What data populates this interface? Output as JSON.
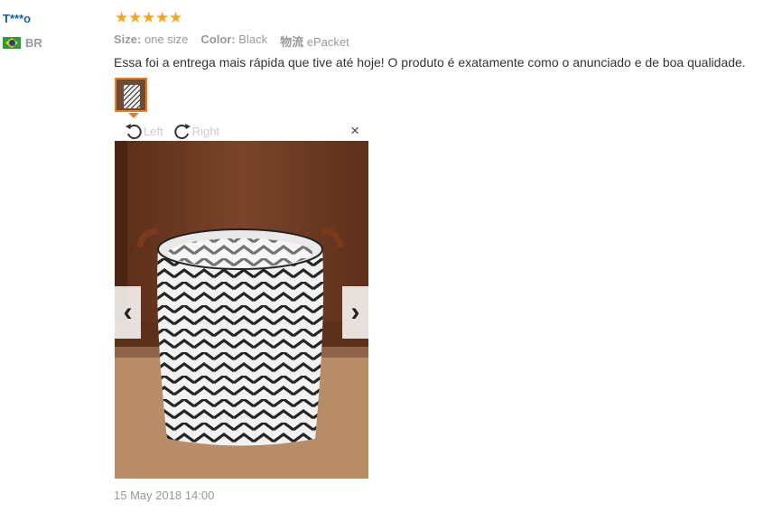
{
  "reviewer": {
    "name": "T***o",
    "country": "BR"
  },
  "rating": {
    "stars": 5,
    "max": 5
  },
  "attributes": [
    {
      "key": "Size:",
      "value": "one size"
    },
    {
      "key": "Color:",
      "value": "Black"
    },
    {
      "key": "物流",
      "value": "ePacket"
    }
  ],
  "review_text": "Essa foi a entrega mais rápida que tive até hoje! O produto é exatamente como o anunciado e de boa qualidade.",
  "viewer": {
    "rotate_left": "Left",
    "rotate_right": "Right",
    "close": "×",
    "prev": "‹",
    "next": "›"
  },
  "date": "15 May 2018 14:00",
  "colors": {
    "accent": "#f07c1c",
    "star": "#f7a51e",
    "name": "#0f5ea6"
  }
}
